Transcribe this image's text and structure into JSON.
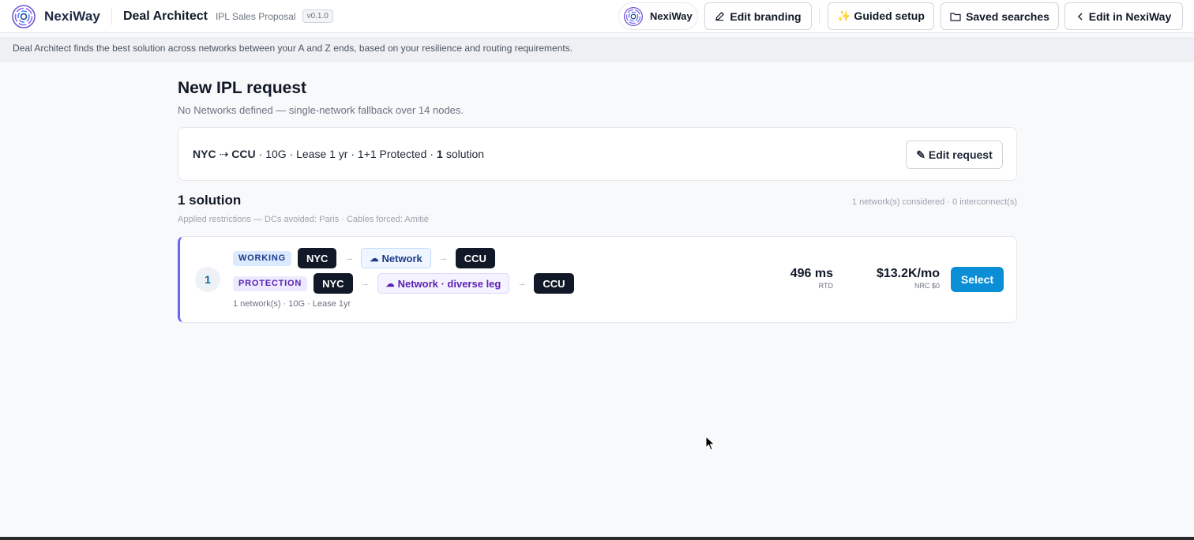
{
  "header": {
    "brand_name": "NexiWay",
    "app_title": "Deal Architect",
    "app_subtitle": "IPL Sales Proposal",
    "version": "v0.1.0",
    "tenant_pill": "NexiWay",
    "edit_branding": "Edit branding",
    "guided_setup": "✨ Guided setup",
    "saved_searches": "Saved searches",
    "edit_in": "Edit in NexiWay"
  },
  "info_text": "Deal Architect finds the best solution across networks between your A and Z ends, based on your resilience and routing requirements.",
  "page": {
    "title": "New IPL request",
    "note": "No Networks defined — single-network fallback over 14 nodes."
  },
  "request": {
    "a": "NYC",
    "arrow": "⇢",
    "z": "CCU",
    "details": "· 10G · Lease 1 yr · 1+1 Protected ·",
    "count": "1",
    "count_label": "solution",
    "edit_label": "✎ Edit request"
  },
  "results": {
    "heading": "1 solution",
    "considered": "1 network(s) considered · 0 interconnect(s)",
    "restrictions": "Applied restrictions — DCs avoided: Paris · Cables forced: Amitié"
  },
  "solution": {
    "rank": "1",
    "working": {
      "tag": "WORKING",
      "a": "NYC",
      "network": "Network",
      "z": "CCU"
    },
    "protection": {
      "tag": "PROTECTION",
      "a": "NYC",
      "network": "Network · diverse leg",
      "z": "CCU"
    },
    "arrow": "→",
    "footer": "1 network(s) · 10G · Lease 1yr",
    "latency_value": "496 ms",
    "latency_label": "RTD",
    "price_value": "$13.2K/mo",
    "price_label": "NRC $0",
    "select_label": "Select"
  },
  "colors": {
    "accent": "#6366f1",
    "primary_button": "#0a8fd6",
    "node_bg": "#111827"
  }
}
